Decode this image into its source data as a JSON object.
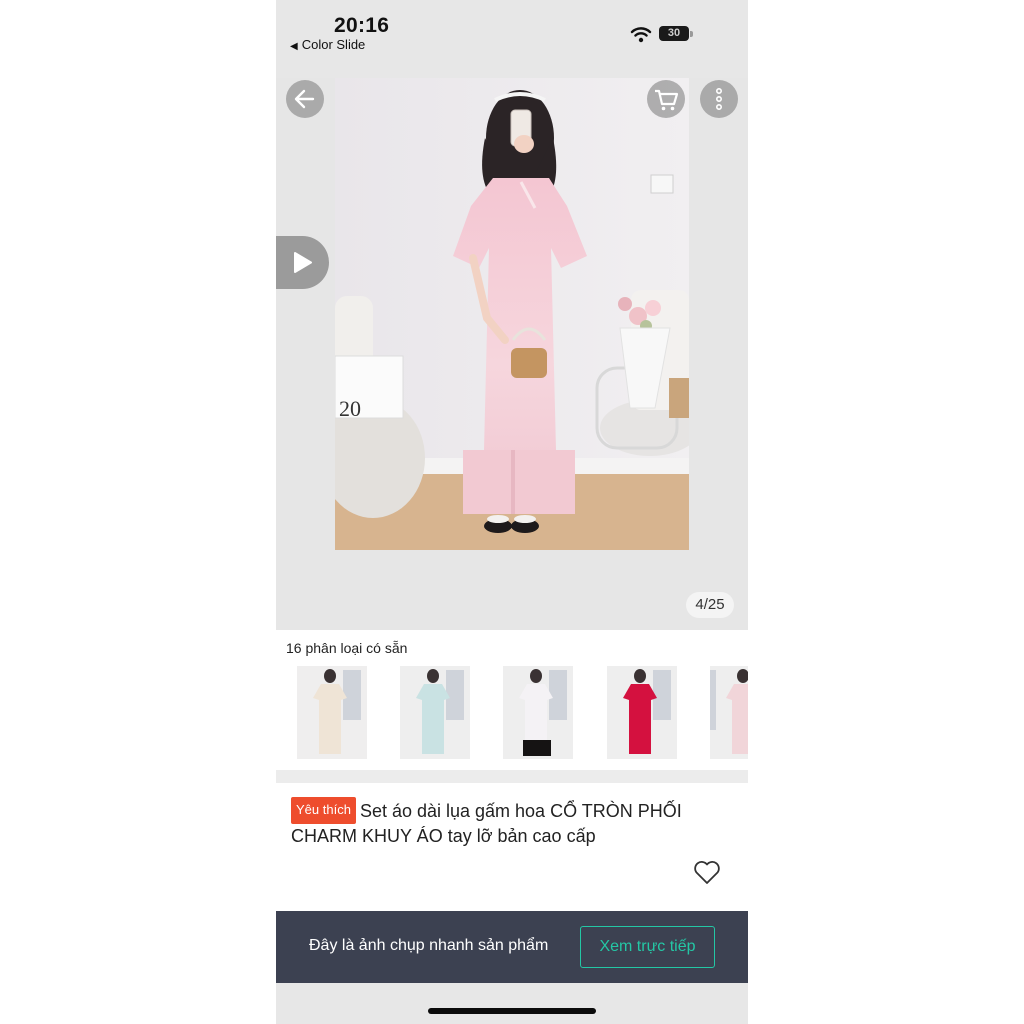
{
  "status_bar": {
    "time": "20:16",
    "back_app_label": "Color Slide",
    "battery_level": "30"
  },
  "gallery": {
    "counter": "4/25",
    "icons": [
      "back-arrow-icon",
      "cart-icon",
      "more-vertical-icon",
      "play-icon"
    ]
  },
  "variants": {
    "title": "16 phân loại có sẵn",
    "thumb_colors": [
      "#efe4d6",
      "#c9e2e3",
      "#f1eef2",
      "#d4113f",
      "#f1d5d9"
    ]
  },
  "product": {
    "badge": "Yêu thích",
    "badge_color": "#ee4d2d",
    "title": "Set áo dài lụa gấm hoa CỔ TRÒN PHỐI CHARM KHUY ÁO tay lỡ bản cao cấp"
  },
  "snapshot": {
    "text": "Đây là ảnh chụp nhanh sản phẩm",
    "button_label": "Xem trực tiếp",
    "accent": "#24c7a5",
    "background": "#3c4151"
  }
}
